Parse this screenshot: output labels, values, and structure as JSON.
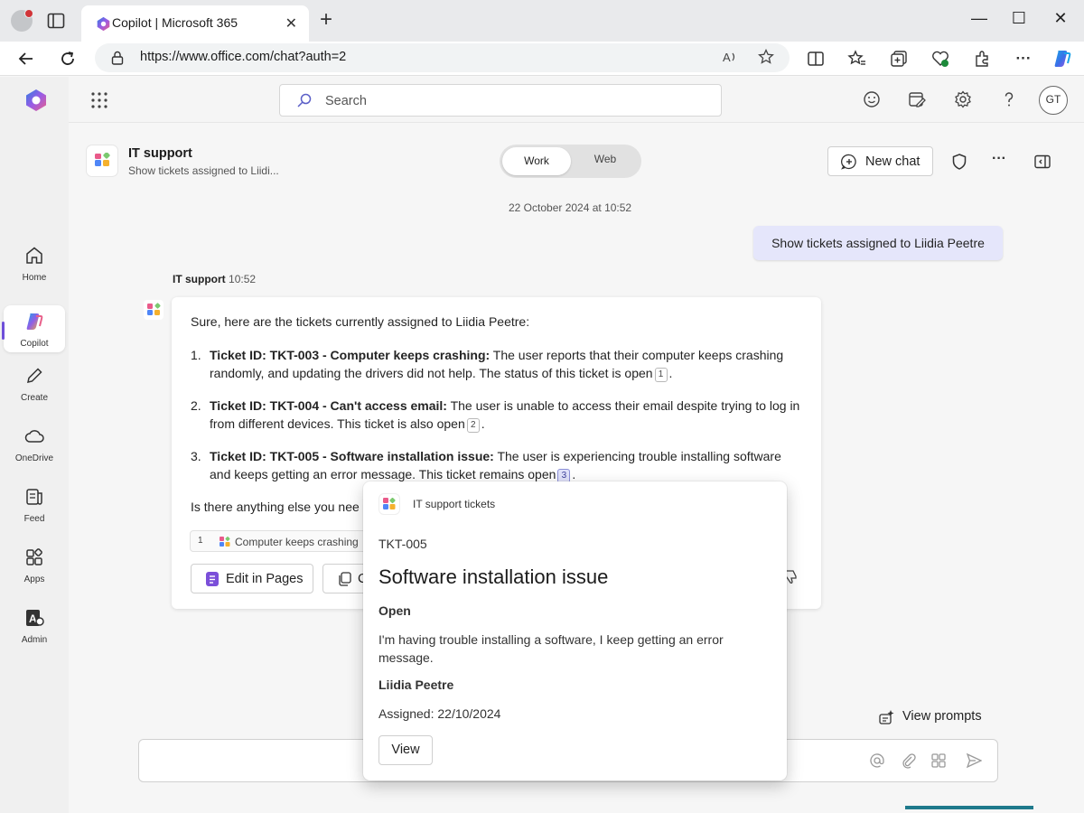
{
  "browser": {
    "tab_title": "Copilot | Microsoft 365",
    "url": "https://www.office.com/chat?auth=2",
    "close_glyph": "✕",
    "new_tab_glyph": "+",
    "window_controls": [
      "—",
      "☐",
      "✕"
    ]
  },
  "topbar": {
    "search_placeholder": "Search",
    "avatar_initials": "GT"
  },
  "rail": {
    "items": [
      {
        "label": "Home",
        "icon": "home-icon"
      },
      {
        "label": "Copilot",
        "icon": "copilot-icon"
      },
      {
        "label": "Create",
        "icon": "pen-icon"
      },
      {
        "label": "OneDrive",
        "icon": "cloud-icon"
      },
      {
        "label": "Feed",
        "icon": "feed-icon"
      },
      {
        "label": "Apps",
        "icon": "apps-icon"
      },
      {
        "label": "Admin",
        "icon": "admin-icon"
      }
    ]
  },
  "agent": {
    "name": "IT support",
    "subtitle": "Show tickets assigned to Liidi..."
  },
  "mode_toggle": {
    "work": "Work",
    "web": "Web",
    "selected": "Work"
  },
  "header": {
    "new_chat_label": "New chat"
  },
  "chat": {
    "timestamp": "22 October 2024 at 10:52",
    "user_message": "Show tickets assigned to Liidia Peetre",
    "bot_name": "IT support",
    "bot_time": "10:52",
    "intro": "Sure, here are the tickets currently assigned to Liidia Peetre:",
    "tickets": [
      {
        "num": "1.",
        "title": "Ticket ID: TKT-003 - Computer keeps crashing:",
        "text": " The user reports that their computer keeps crashing randomly, and updating the drivers did not help. The status of this ticket is open",
        "cite": "1",
        "end": "."
      },
      {
        "num": "2.",
        "title": "Ticket ID: TKT-004 - Can't access email:",
        "text": " The user is unable to access their email despite trying to log in from different devices. This ticket is also open",
        "cite": "2",
        "end": "."
      },
      {
        "num": "3.",
        "title": "Ticket ID: TKT-005 - Software installation issue:",
        "text": " The user is experiencing trouble installing software and keeps getting an error message. This ticket remains open",
        "cite": "3",
        "end": "."
      }
    ],
    "followup": "Is there anything else you nee",
    "reference": {
      "num": "1",
      "text": "Computer keeps crashing"
    },
    "edit_label": "Edit in Pages",
    "copy_label": "C"
  },
  "view_prompts_label": "View prompts",
  "popup": {
    "source": "IT support tickets",
    "ticket_id": "TKT-005",
    "title": "Software installation issue",
    "status": "Open",
    "description": "I'm having trouble installing a software, I keep getting an error message.",
    "assignee": "Liidia Peetre",
    "assigned": "Assigned: 22/10/2024",
    "view_label": "View"
  },
  "colors": {
    "accent": "#6e4fd9",
    "user_bubble": "#e5e6fb",
    "teal_bar": "#1f7a8c"
  }
}
